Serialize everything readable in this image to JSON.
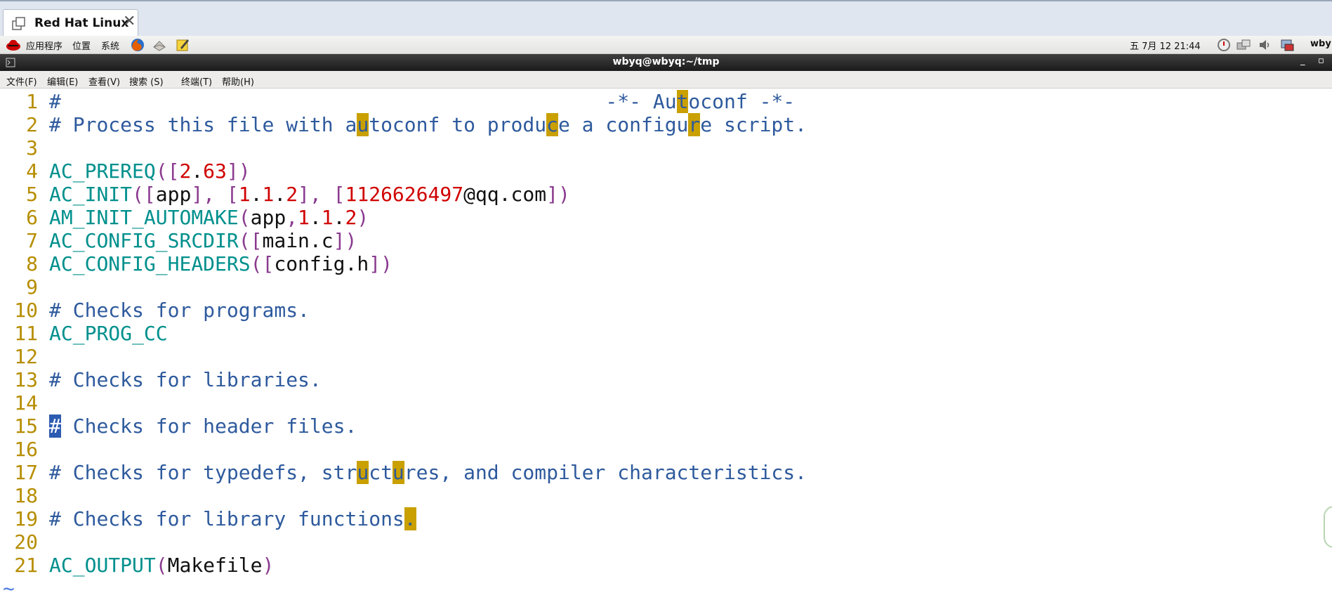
{
  "browser_tab": {
    "title": "Red Hat Linux",
    "close_glyph": "✕"
  },
  "panel": {
    "menus": [
      "应用程序",
      "位置",
      "系统"
    ],
    "launchers": [
      "firefox-icon",
      "mail-icon",
      "notes-icon"
    ],
    "clock": "五 7月 12 21:44",
    "tray": [
      "update-icon",
      "network-icon",
      "volume-icon",
      "display-icon"
    ],
    "user": "wby"
  },
  "terminal": {
    "title": "wbyq@wbyq:~/tmp",
    "minimize": "_",
    "maximize": "▫",
    "menu": [
      "文件(F)",
      "编辑(E)",
      "查看(V)",
      "搜索 (S)",
      "终端(T)",
      "帮助(H)"
    ]
  },
  "editor": {
    "lines": [
      {
        "n": "1",
        "code": "#                                              -*- Autoconf -*-"
      },
      {
        "n": "2",
        "code": "# Process this file with autoconf to produce a configure script."
      },
      {
        "n": "3",
        "code": ""
      },
      {
        "n": "4",
        "code": "AC_PREREQ([2.63])"
      },
      {
        "n": "5",
        "code": "AC_INIT([app], [1.1.2], [1126626497@qq.com])"
      },
      {
        "n": "6",
        "code": "AM_INIT_AUTOMAKE(app,1.1.2)"
      },
      {
        "n": "7",
        "code": "AC_CONFIG_SRCDIR([main.c])"
      },
      {
        "n": "8",
        "code": "AC_CONFIG_HEADERS([config.h])"
      },
      {
        "n": "9",
        "code": ""
      },
      {
        "n": "10",
        "code": "# Checks for programs."
      },
      {
        "n": "11",
        "code": "AC_PROG_CC"
      },
      {
        "n": "12",
        "code": ""
      },
      {
        "n": "13",
        "code": "# Checks for libraries."
      },
      {
        "n": "14",
        "code": ""
      },
      {
        "n": "15",
        "code": "# Checks for header files."
      },
      {
        "n": "16",
        "code": ""
      },
      {
        "n": "17",
        "code": "# Checks for typedefs, structures, and compiler characteristics."
      },
      {
        "n": "18",
        "code": ""
      },
      {
        "n": "19",
        "code": "# Checks for library functions."
      },
      {
        "n": "20",
        "code": ""
      },
      {
        "n": "21",
        "code": "AC_OUTPUT(Makefile)"
      }
    ],
    "empty_marker": "~",
    "search_highlight": "u",
    "colors": {
      "comment": "#2e5a9d",
      "keyword": "#00908d",
      "paren": "#8a3a8f",
      "number": "#d00000",
      "line_number": "#b68d00",
      "highlight": "#c9a000",
      "cursor": "#2d5bb1"
    }
  }
}
